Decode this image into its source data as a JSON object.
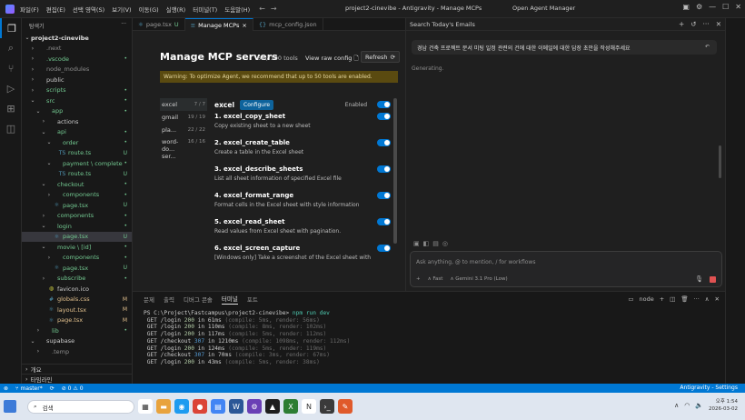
{
  "titlebar": {
    "menu": [
      "파일(F)",
      "편집(E)",
      "선택 영역(S)",
      "보기(V)",
      "이동(G)",
      "실행(R)",
      "터미널(T)",
      "도움말(H)"
    ],
    "window_title": "project2-cinevibe - Antigravity - Manage MCPs",
    "agent_manager": "Open Agent Manager"
  },
  "explorer": {
    "header": "탐색기",
    "root": "project2-cinevibe",
    "rows": [
      {
        "label": ".next",
        "chev": "›",
        "icon": "▸",
        "badge": "",
        "dim": true,
        "indent": 1
      },
      {
        "label": ".vscode",
        "chev": "›",
        "icon": "▸",
        "badge": "•",
        "dim": false,
        "indent": 1
      },
      {
        "label": "node_modules",
        "chev": "›",
        "icon": "▸",
        "badge": "",
        "dim": true,
        "indent": 1
      },
      {
        "label": "public",
        "chev": "›",
        "icon": "▸",
        "badge": "",
        "dim": false,
        "indent": 1
      },
      {
        "label": "scripts",
        "chev": "›",
        "icon": "▸",
        "badge": "•",
        "dim": false,
        "indent": 1
      },
      {
        "label": "src",
        "chev": "⌄",
        "icon": "▾",
        "badge": "•",
        "dim": false,
        "indent": 1
      },
      {
        "label": "app",
        "chev": "⌄",
        "icon": "▾",
        "badge": "•",
        "dim": false,
        "indent": 2
      },
      {
        "label": "actions",
        "chev": "›",
        "icon": "▸",
        "badge": "",
        "dim": false,
        "indent": 3
      },
      {
        "label": "api",
        "chev": "⌄",
        "icon": "▾",
        "badge": "•",
        "dim": false,
        "indent": 3
      },
      {
        "label": "order",
        "chev": "⌄",
        "icon": "▾",
        "badge": "•",
        "dim": false,
        "indent": 4
      },
      {
        "label": "route.ts",
        "chev": "",
        "icon": "TS",
        "badge": "U",
        "dim": false,
        "indent": 5
      },
      {
        "label": "payment \\ complete",
        "chev": "⌄",
        "icon": "▾",
        "badge": "•",
        "dim": false,
        "indent": 4
      },
      {
        "label": "route.ts",
        "chev": "",
        "icon": "TS",
        "badge": "U",
        "dim": false,
        "indent": 5
      },
      {
        "label": "checkout",
        "chev": "⌄",
        "icon": "▾",
        "badge": "•",
        "dim": false,
        "indent": 3
      },
      {
        "label": "components",
        "chev": "›",
        "icon": "▸",
        "badge": "•",
        "dim": false,
        "indent": 4
      },
      {
        "label": "page.tsx",
        "chev": "",
        "icon": "⚛",
        "badge": "U",
        "dim": false,
        "indent": 4
      },
      {
        "label": "components",
        "chev": "›",
        "icon": "▸",
        "badge": "•",
        "dim": false,
        "indent": 3
      },
      {
        "label": "login",
        "chev": "⌄",
        "icon": "▾",
        "badge": "•",
        "dim": false,
        "indent": 3
      },
      {
        "label": "page.tsx",
        "chev": "",
        "icon": "⚛",
        "badge": "U",
        "dim": false,
        "indent": 4,
        "sel": true
      },
      {
        "label": "movie \\ [id]",
        "chev": "⌄",
        "icon": "▾",
        "badge": "•",
        "dim": false,
        "indent": 3
      },
      {
        "label": "components",
        "chev": "›",
        "icon": "▸",
        "badge": "•",
        "dim": false,
        "indent": 4
      },
      {
        "label": "page.tsx",
        "chev": "",
        "icon": "⚛",
        "badge": "U",
        "dim": false,
        "indent": 4
      },
      {
        "label": "subscribe",
        "chev": "›",
        "icon": "▸",
        "badge": "•",
        "dim": false,
        "indent": 3
      },
      {
        "label": "favicon.ico",
        "chev": "",
        "icon": "◍",
        "badge": "",
        "dim": false,
        "indent": 3
      },
      {
        "label": "globals.css",
        "chev": "",
        "icon": "#",
        "badge": "M",
        "dim": false,
        "indent": 3
      },
      {
        "label": "layout.tsx",
        "chev": "",
        "icon": "⚛",
        "badge": "M",
        "dim": false,
        "indent": 3
      },
      {
        "label": "page.tsx",
        "chev": "",
        "icon": "⚛",
        "badge": "M",
        "dim": false,
        "indent": 3
      },
      {
        "label": "lib",
        "chev": "›",
        "icon": "▸",
        "badge": "•",
        "dim": false,
        "indent": 2
      },
      {
        "label": "supabase",
        "chev": "⌄",
        "icon": "▾",
        "badge": "",
        "dim": false,
        "indent": 1
      },
      {
        "label": ".temp",
        "chev": "›",
        "icon": "▸",
        "badge": "",
        "dim": true,
        "indent": 2
      }
    ],
    "outline": "개요",
    "timeline": "타임라인"
  },
  "tabs": [
    {
      "label": "page.tsx",
      "status": "U",
      "active": false
    },
    {
      "label": "Manage MCPs",
      "status": "×",
      "active": true
    },
    {
      "label": "mcp_config.json",
      "status": "",
      "active": false
    }
  ],
  "mcp": {
    "title": "Manage MCP servers",
    "count": "64 / 100 tools",
    "view_raw": "View raw config",
    "refresh": "Refresh",
    "warning": "Warning: To optimize Agent, we recommend that up to 50 tools are enabled.",
    "servers": [
      {
        "name": "excel",
        "count": "7 / 7",
        "active": true
      },
      {
        "name": "gmail",
        "count": "19 / 19",
        "active": false
      },
      {
        "name": "pla...",
        "count": "22 / 22",
        "active": false
      },
      {
        "name": "word-do... ser...",
        "count": "16 / 16",
        "active": false
      }
    ],
    "selected": {
      "name": "excel",
      "configure": "Configure",
      "enabled_label": "Enabled",
      "enabled": true
    },
    "tools": [
      {
        "name": "1. excel_copy_sheet",
        "desc": "Copy existing sheet to a new sheet"
      },
      {
        "name": "2. excel_create_table",
        "desc": "Create a table in the Excel sheet"
      },
      {
        "name": "3. excel_describe_sheets",
        "desc": "List all sheet information of specified Excel file"
      },
      {
        "name": "4. excel_format_range",
        "desc": "Format cells in the Excel sheet with style information"
      },
      {
        "name": "5. excel_read_sheet",
        "desc": "Read values from Excel sheet with pagination."
      },
      {
        "name": "6. excel_screen_capture",
        "desc": "[Windows only] Take a screenshot of the Excel sheet with"
      }
    ]
  },
  "agent": {
    "header": "Search Today's Emails",
    "user_message": "경남 건축 프로젝트 문서 미팅 일정 관련의 건에 대한 이메일에 대한 답장 초안을 작성해주세요",
    "status": "Generating.",
    "input_placeholder": "Ask anything, @ to mention, / for workflows",
    "mode": "Fast",
    "model": "Gemini 3.1 Pro (Low)"
  },
  "terminal": {
    "tabs": [
      "문제",
      "출력",
      "디버그 콘솔",
      "터미널",
      "포트"
    ],
    "active_tab": "터미널",
    "shell": "node",
    "prompt": "PS C:\\Project\\Fastcampus\\project2-cinevibe> ",
    "command": "npm run dev",
    "lines": [
      {
        "method": "GET",
        "path": "/login",
        "code": "200",
        "time": "61ms",
        "detail": "(compile: 5ms, render: 56ms)"
      },
      {
        "method": "GET",
        "path": "/login",
        "code": "200",
        "time": "110ms",
        "detail": "(compile: 8ms, render: 102ms)"
      },
      {
        "method": "GET",
        "path": "/login",
        "code": "200",
        "time": "117ms",
        "detail": "(compile: 5ms, render: 112ms)"
      },
      {
        "method": "GET",
        "path": "/checkout",
        "code": "307",
        "time": "1210ms",
        "detail": "(compile: 1098ms, render: 112ms)"
      },
      {
        "method": "GET",
        "path": "/login",
        "code": "200",
        "time": "124ms",
        "detail": "(compile: 5ms, render: 119ms)"
      },
      {
        "method": "GET",
        "path": "/checkout",
        "code": "307",
        "time": "70ms",
        "detail": "(compile: 3ms, render: 67ms)"
      },
      {
        "method": "GET",
        "path": "/login",
        "code": "200",
        "time": "43ms",
        "detail": "(compile: 5ms, render: 38ms)"
      }
    ]
  },
  "statusbar": {
    "branch": "master*",
    "right": "Antigravity - Settings"
  },
  "taskbar": {
    "search_placeholder": "검색",
    "time": "오후 1:54",
    "date": "2026-03-02"
  },
  "colors": {
    "accent": "#0078d4",
    "warning_bg": "#5a4a10",
    "untracked": "#73c991",
    "modified": "#e2c08d"
  }
}
